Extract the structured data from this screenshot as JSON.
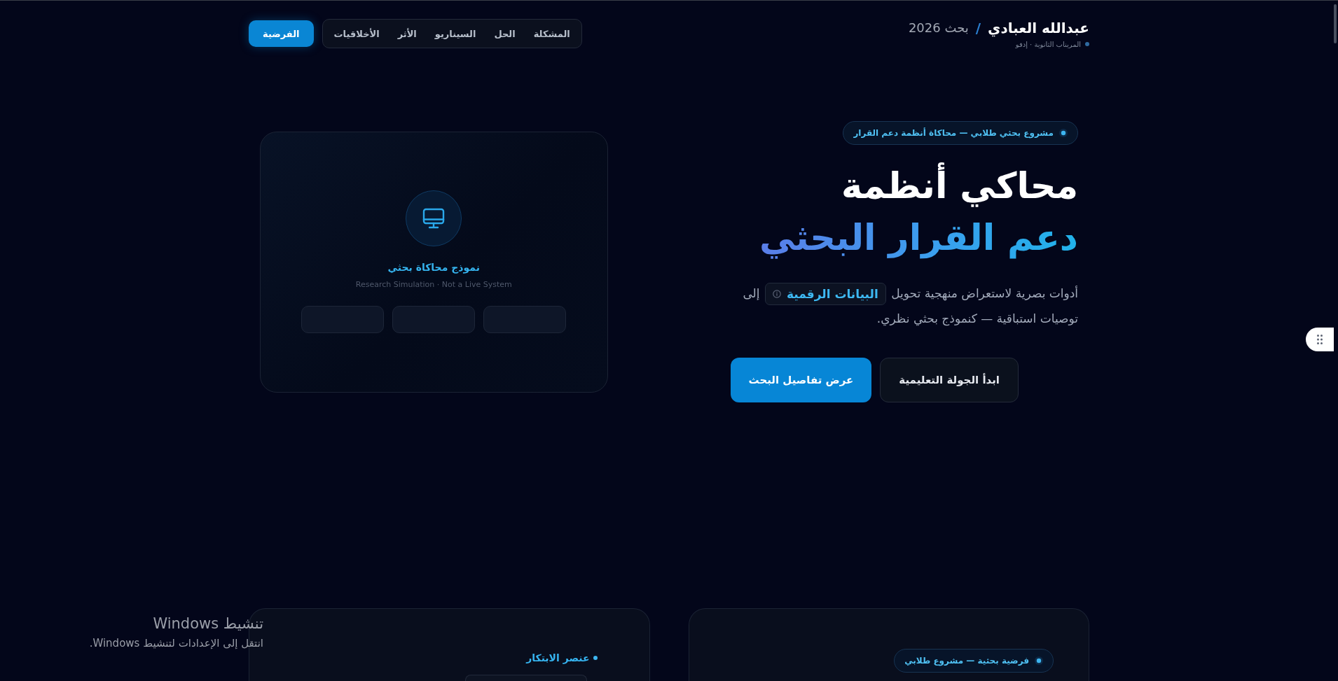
{
  "brand": {
    "name": "عبدالله العبادي",
    "separator": "/",
    "project": "بحث 2026",
    "location": "المريناب الثانوية · إدفو"
  },
  "nav": {
    "items": [
      "المشكلة",
      "الحل",
      "السيناريو",
      "الأثر",
      "الأخلاقيات"
    ],
    "cta": "الفرضية"
  },
  "hero": {
    "badge": "مشروع بحثي طلابي — محاكاة أنظمة دعم القرار",
    "title_lines": [
      {
        "kind": "plain",
        "text": "محاكي أنظمة"
      },
      {
        "kind": "gradient",
        "text": "دعم القرار البحثي"
      }
    ],
    "description": [
      {
        "kind": "text",
        "text": "أدوات بصرية لاستعراض منهجية تحويل"
      },
      {
        "kind": "term",
        "text": "البيانات الرقمية"
      },
      {
        "kind": "text",
        "text": "إلى"
      },
      {
        "kind": "text",
        "text": "توصيات استباقية — كنموذج بحثي نظري."
      }
    ],
    "buttons": [
      {
        "kind": "secondary",
        "label": "ابدأ الجولة التعليمية"
      },
      {
        "kind": "primary",
        "label": "عرض تفاصيل البحث"
      }
    ]
  },
  "simulation_card": {
    "title": "نموذج محاكاة بحثي",
    "subtitle": "Research Simulation · Not a Live System"
  },
  "preview_cards": [
    {
      "kind": "badge",
      "text": "فرضية بحثية — مشروع طلابي"
    },
    {
      "kind": "heading",
      "text": "عنصر الابتكار"
    }
  ],
  "os_notice": {
    "title": "تنشيط Windows",
    "message": "انتقل إلى الإعدادات لتنشيط Windows."
  }
}
